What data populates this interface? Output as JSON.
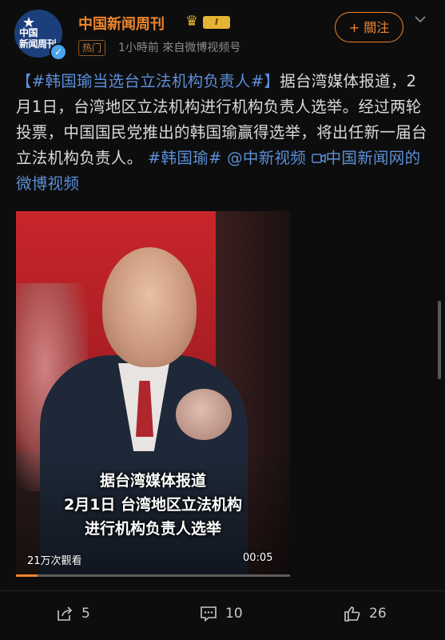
{
  "account": {
    "logo_text": "中国\n新闻周刊",
    "name": "中国新闻周刊",
    "level_badge": "I",
    "hot_tag": "热门",
    "meta": "1小時前  來自微博视频号",
    "follow_label": "+ 關注"
  },
  "post": {
    "topic_tag": "【#韩国瑜当选台立法机构负责人#】",
    "body": "据台湾媒体报道，2月1日，台湾地区立法机构进行机构负责人选举。经过两轮投票，中国国民党推出的韩国瑜赢得选举，将出任新一届台立法机构负责人。",
    "hashtag": "#韩国瑜#",
    "mention": "@中新视频",
    "video_link": "中国新闻网的微博视频"
  },
  "video": {
    "caption_lines": [
      "据台湾媒体报道",
      "2月1日 台湾地区立法机构",
      "进行机构负责人选举"
    ],
    "views": "21万次觀看",
    "duration": "00:05",
    "progress": 0.08
  },
  "actions": {
    "share_count": "5",
    "comment_count": "10",
    "like_count": "26"
  },
  "colors": {
    "accent": "#f0852d",
    "link": "#5b8fd9",
    "background": "#0d0d0d"
  }
}
